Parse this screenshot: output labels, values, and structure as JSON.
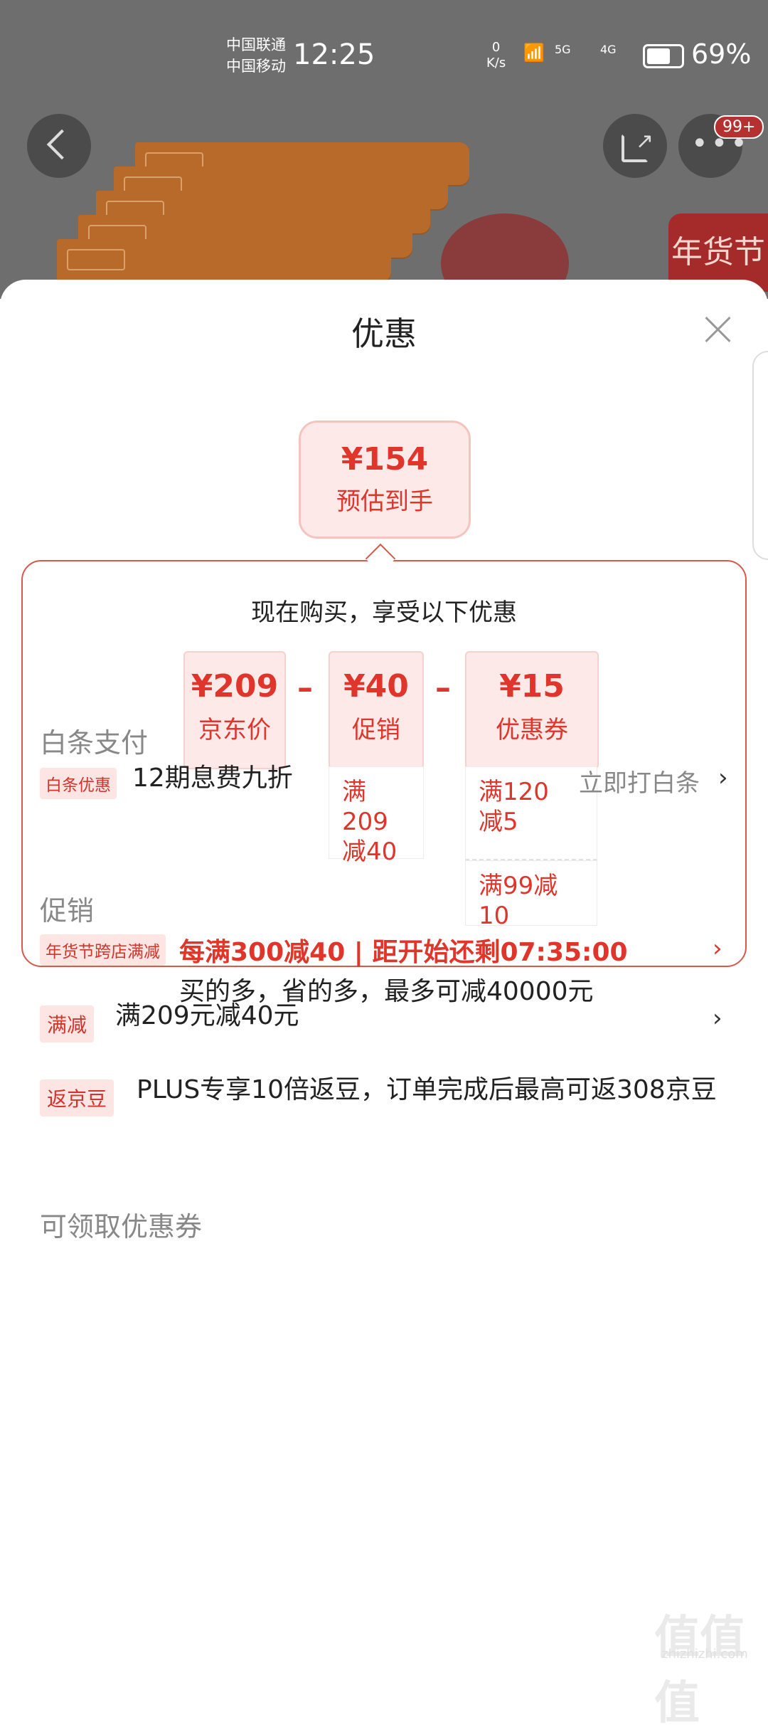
{
  "status_bar": {
    "carrier1": "中国联通",
    "carrier2": "中国移动",
    "time": "12:25",
    "speed_value": "0",
    "speed_unit": "K/s",
    "signal1": "5G",
    "signal2": "4G",
    "battery_pct": "69%",
    "battery_level": 0.69
  },
  "top_bar": {
    "more_badge": "99+",
    "festival_badge": "年货节"
  },
  "sheet": {
    "title": "优惠",
    "estimate": {
      "price": "¥154",
      "label": "预估到手"
    },
    "breakdown": {
      "title": "现在购买，享受以下优惠",
      "items": [
        {
          "price": "¥209",
          "label": "京东价"
        },
        {
          "price": "¥40",
          "label": "促销"
        },
        {
          "price": "¥15",
          "label": "优惠券"
        }
      ],
      "minus": "–",
      "promo_condition": "满209\n减40",
      "coupon_conditions": [
        "满120\n减5",
        "满99减10"
      ]
    },
    "baitiao": {
      "header": "白条支付",
      "tag": "白条优惠",
      "text": "12期息费九折",
      "link": "立即打白条"
    },
    "promotions": {
      "header": "促销",
      "items": [
        {
          "tag": "年货节跨店满减",
          "headline": "每满300减40 | 距开始还剩07:35:00",
          "text": "买的多，省的多，最多可减40000元"
        },
        {
          "tag": "满减",
          "text": "满209元减40元"
        },
        {
          "tag": "返京豆",
          "text": "PLUS专享10倍返豆，订单完成后最高可返308京豆"
        }
      ]
    },
    "coupons_header": "可领取优惠券"
  },
  "watermark": {
    "text": "值值值",
    "sub": "zhizhizhi.com"
  }
}
